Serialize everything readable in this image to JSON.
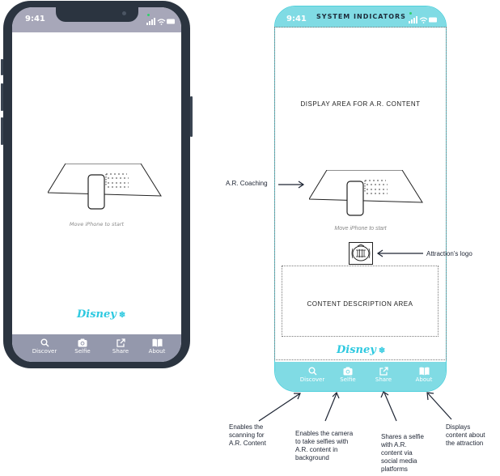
{
  "left_phone": {
    "status_time": "9:41",
    "move_hint": "Move iPhone to start",
    "brand": "Disney",
    "tabs": [
      {
        "label": "Discover",
        "icon": "search-icon"
      },
      {
        "label": "Selfie",
        "icon": "camera-icon"
      },
      {
        "label": "Share",
        "icon": "share-icon"
      },
      {
        "label": "About",
        "icon": "book-icon"
      }
    ]
  },
  "right_phone": {
    "status_time": "9:41",
    "header": "SYSTEM INDICATORS",
    "display_area": "DISPLAY AREA FOR A.R. CONTENT",
    "move_hint": "Move iPhone to start",
    "content_description": "CONTENT DESCRIPTION AREA",
    "brand": "Disney",
    "tabs": [
      {
        "label": "Discover",
        "icon": "search-icon"
      },
      {
        "label": "Selfie",
        "icon": "camera-icon"
      },
      {
        "label": "Share",
        "icon": "share-icon"
      },
      {
        "label": "About",
        "icon": "book-icon"
      }
    ]
  },
  "annotations": {
    "ar_coaching": "A.R. Coaching",
    "attraction_logo": "Attraction’s logo",
    "discover": [
      "Enables the",
      "scanning for",
      "A.R. Content"
    ],
    "selfie": [
      "Enables the camera",
      "to take selfies with",
      "A.R. content in",
      "background"
    ],
    "share": [
      "Shares a selfie",
      "with A.R.",
      "content via",
      "social media",
      "platforms"
    ],
    "about": [
      "Displays",
      "content about",
      "the attraction"
    ]
  },
  "colors": {
    "accent": "#80dbe4",
    "left_tabbar": "#9498ac",
    "left_status": "#a7a7b9",
    "phone_frame": "#2b3440",
    "disney": "#2ec9e0"
  }
}
